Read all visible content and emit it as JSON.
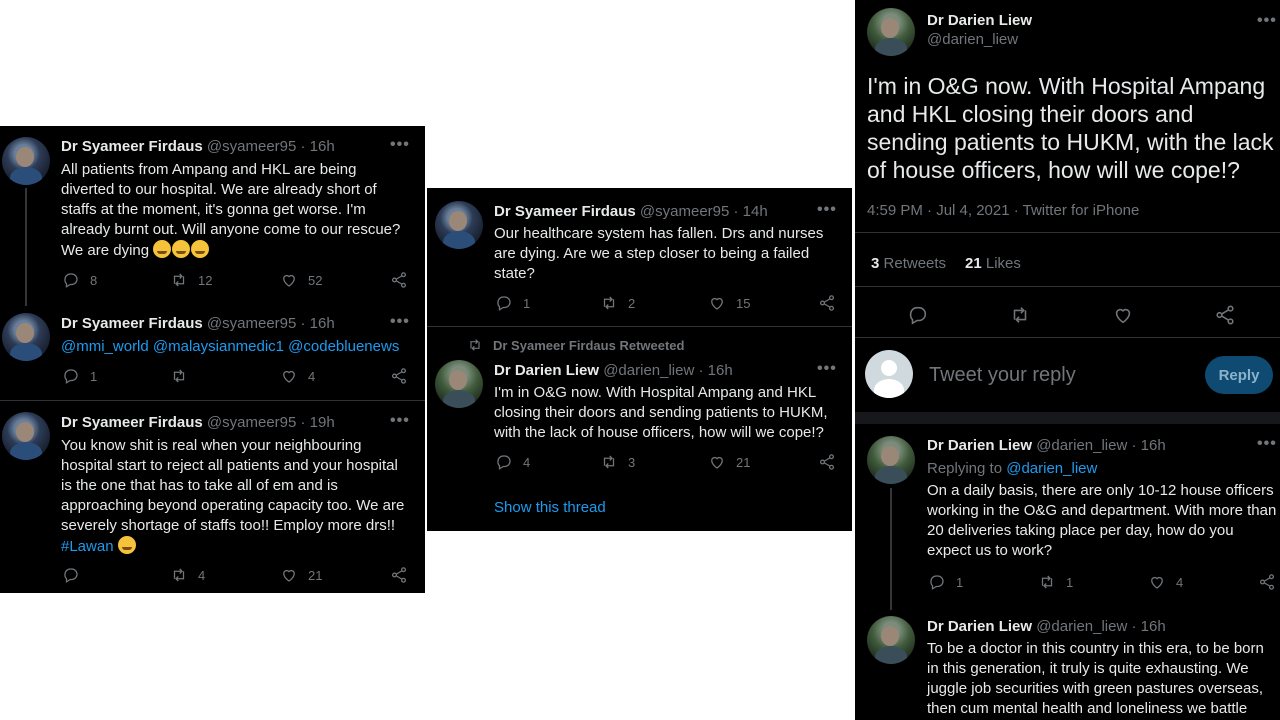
{
  "panel1": {
    "tweets": [
      {
        "name": "Dr Syameer Firdaus",
        "handle": "@syameer95",
        "time": "· 16h",
        "lines": [
          "All patients from Ampang and HKL are being",
          "diverted to our hospital. We are already short of",
          "staffs at the moment, it's gonna get worse. I'm",
          "already burnt out. Will anyone come to our rescue?",
          "We are dying"
        ],
        "replies": "8",
        "retweets": "12",
        "likes": "52"
      },
      {
        "name": "Dr Syameer Firdaus",
        "handle": "@syameer95",
        "time": "· 16h",
        "mentions": "@mmi_world @malaysianmedic1 @codebluenews",
        "replies": "1",
        "retweets": "",
        "likes": "4"
      },
      {
        "name": "Dr Syameer Firdaus",
        "handle": "@syameer95",
        "time": "· 19h",
        "lines": [
          "You know shit is real when your neighbouring",
          "hospital start to reject all patients and your hospital",
          "is the one that has to take all of em and is",
          "approaching beyond operating capacity too. We are",
          "severely shortage of staffs too!! Employ more drs!!"
        ],
        "hashtag": "#Lawan",
        "replies": "",
        "retweets": "4",
        "likes": "21"
      }
    ]
  },
  "panel2": {
    "tweet1": {
      "name": "Dr Syameer Firdaus",
      "handle": "@syameer95",
      "time": "· 14h",
      "lines": [
        "Our healthcare system has fallen. Drs and nurses",
        "are dying. Are we a step closer to being a failed",
        "state?"
      ],
      "replies": "1",
      "retweets": "2",
      "likes": "15"
    },
    "retweet_label": "Dr Syameer Firdaus Retweeted",
    "tweet2": {
      "name": "Dr Darien Liew",
      "handle": "@darien_liew",
      "time": "· 16h",
      "lines": [
        "I'm in O&G now. With Hospital Ampang and HKL",
        "closing their doors and sending patients to HUKM,",
        "with the lack of house officers, how will we cope!?"
      ],
      "replies": "4",
      "retweets": "3",
      "likes": "21"
    },
    "show_thread": "Show this thread"
  },
  "panel3": {
    "main": {
      "name": "Dr Darien Liew",
      "handle": "@darien_liew",
      "lines": [
        "I'm in O&G now. With Hospital Ampang",
        "and HKL closing their doors and",
        "sending patients to HUKM, with the lack",
        "of house officers, how will we cope!?"
      ],
      "meta": "4:59 PM · Jul 4, 2021 · Twitter for iPhone",
      "retweets_count": "3",
      "retweets_label": "Retweets",
      "likes_count": "21",
      "likes_label": "Likes"
    },
    "reply_placeholder": "Tweet your reply",
    "reply_button": "Reply",
    "reply1": {
      "name": "Dr Darien Liew",
      "handle": "@darien_liew",
      "time": "· 16h",
      "replying_prefix": "Replying to",
      "replying_to": "@darien_liew",
      "lines": [
        "On a daily basis, there are only 10-12 house officers",
        "working in the O&G and department. With more than",
        "20 deliveries taking place per day, how do you",
        "expect us to work?"
      ],
      "replies": "1",
      "retweets": "1",
      "likes": "4"
    },
    "reply2": {
      "name": "Dr Darien Liew",
      "handle": "@darien_liew",
      "time": "· 16h",
      "lines": [
        "To be a doctor in this country in this era, to be born",
        "in this generation, it truly is quite exhausting. We",
        "juggle job securities with green pastures overseas,",
        "then cum mental health and loneliness we battle"
      ]
    }
  },
  "colors": {
    "background": "#000000",
    "text": "#e7e9ea",
    "muted": "#71767b",
    "accent": "#1d9bf0"
  },
  "icons": [
    "reply-icon",
    "retweet-icon",
    "like-icon",
    "share-icon",
    "more-icon"
  ]
}
